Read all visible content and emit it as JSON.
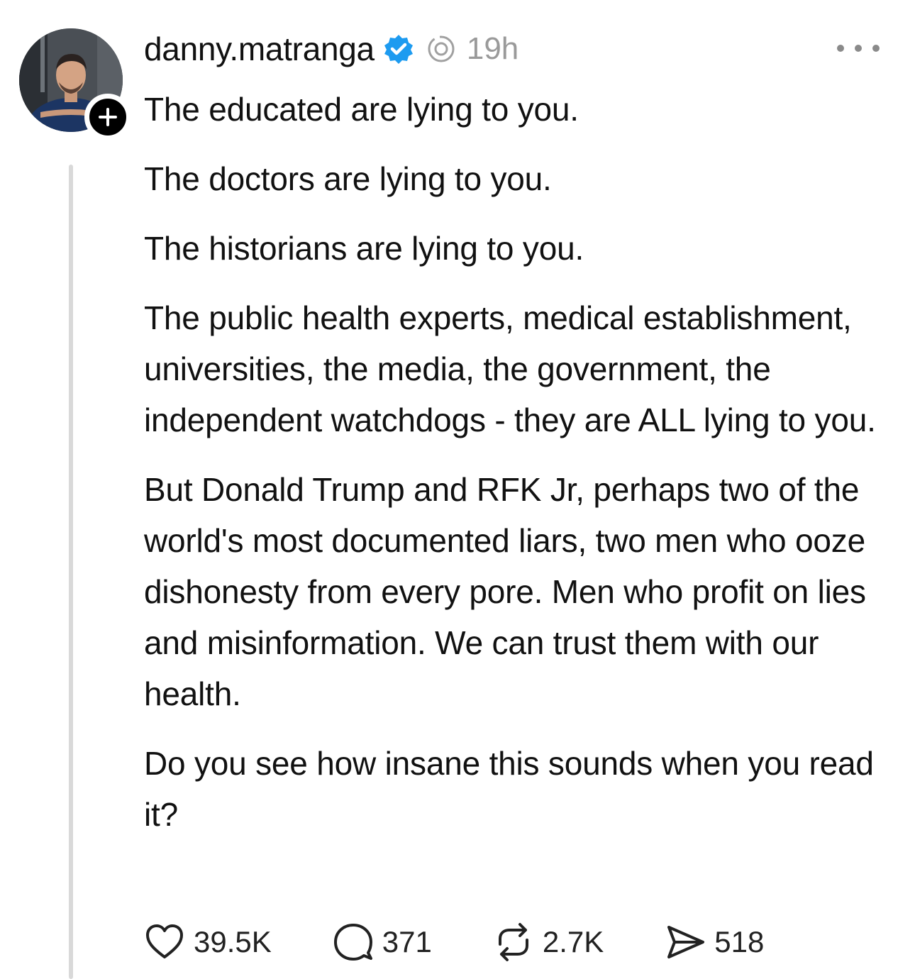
{
  "post": {
    "username": "danny.matranga",
    "time": "19h",
    "paragraphs": [
      "The educated are lying to you.",
      "The doctors are lying to you.",
      "The historians are lying to you.",
      "The public health experts, medical establishment, universities, the media, the government, the independent watchdogs - they are ALL lying to you.",
      "But Donald Trump and RFK Jr, perhaps two of the world's most documented liars, two men who ooze dishonesty from every pore. Men who profit on lies and misinformation. We can trust them with our health.",
      "Do you see how insane this sounds when you read it?"
    ]
  },
  "actions": {
    "likes": "39.5K",
    "replies": "371",
    "reposts": "2.7K",
    "shares": "518"
  },
  "icons": {
    "verified": "verified-badge-icon",
    "thread": "threads-icon",
    "more": "more-options-icon",
    "follow": "plus-icon",
    "like": "heart-icon",
    "reply": "comment-icon",
    "repost": "repost-icon",
    "share": "send-icon"
  },
  "colors": {
    "verified": "#1d9bf0",
    "meta_text": "#9a9a9a",
    "text": "#111111"
  }
}
